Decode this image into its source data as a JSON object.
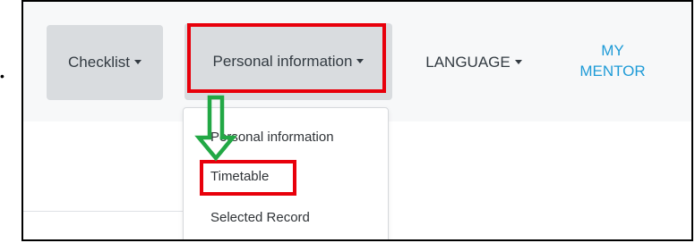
{
  "bullet": "•",
  "navbar": {
    "checklist_label": "Checklist",
    "personal_label": "Personal information",
    "language_label": "LANGUAGE",
    "mentor_line1": "MY",
    "mentor_line2": "MENTOR"
  },
  "dropdown": {
    "items": [
      {
        "label": "Personal information"
      },
      {
        "label": "Timetable"
      },
      {
        "label": "Selected Record"
      }
    ]
  },
  "colors": {
    "highlight": "#e8000b",
    "arrow": "#22a845",
    "link": "#1e9bd7",
    "navbar_bg": "#f7f8f9",
    "button_bg": "#d9dcdf"
  },
  "icons": [
    "chevron-down-icon",
    "down-arrow-icon"
  ]
}
